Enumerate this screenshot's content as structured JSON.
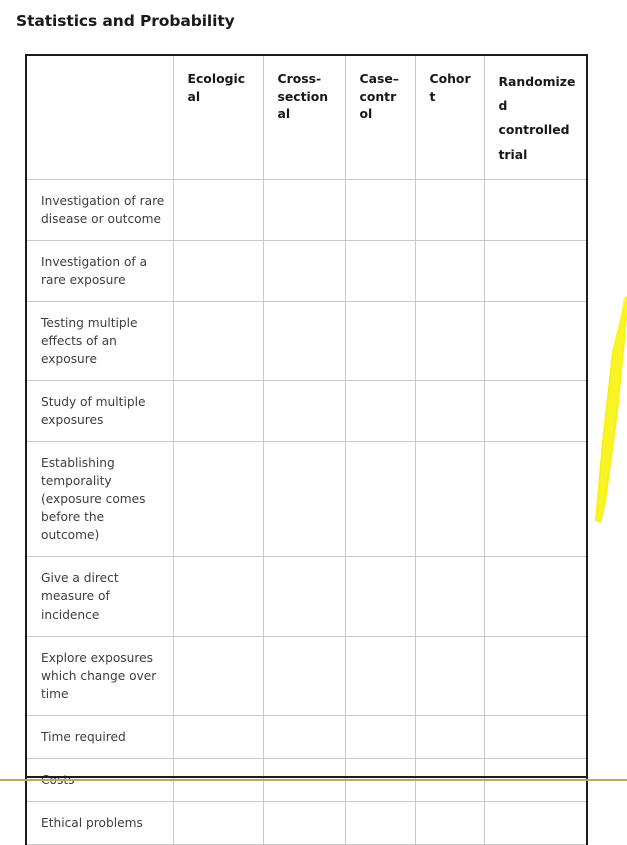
{
  "page": {
    "title": "Statistics and Probability",
    "background_color": "#ffffff",
    "bottom_rule_color": "#c8a464",
    "table_border_color": "#1c1c1c",
    "grid_line_color": "#c9c9c9"
  },
  "table": {
    "corner_header": "",
    "columns": [
      {
        "label": "Ecological"
      },
      {
        "label": "Cross-sectional"
      },
      {
        "label": "Case–control"
      },
      {
        "label": "Randomized controlled trial"
      },
      {
        "label": "Cohort"
      }
    ],
    "column_headers": {
      "ecological": "Ecological",
      "cross_sectional": "Cross-sectional",
      "case_control": "Case–control",
      "cohort": "Cohort",
      "randomized_controlled_trial": "Randomized controlled trial"
    },
    "rows": [
      {
        "label": "Investigation of rare disease or outcome",
        "cells": [
          "",
          "",
          "",
          "",
          ""
        ]
      },
      {
        "label": "Investigation of a rare exposure",
        "cells": [
          "",
          "",
          "",
          "",
          ""
        ]
      },
      {
        "label": "Testing multiple effects of an exposure",
        "cells": [
          "",
          "",
          "",
          "",
          ""
        ]
      },
      {
        "label": "Study of multiple exposures",
        "cells": [
          "",
          "",
          "",
          "",
          ""
        ]
      },
      {
        "label": "Establishing temporality (exposure comes before the outcome)",
        "cells": [
          "",
          "",
          "",
          "",
          ""
        ]
      },
      {
        "label": "Give a direct measure of incidence",
        "cells": [
          "",
          "",
          "",
          "",
          ""
        ]
      },
      {
        "label": "Explore exposures which change over time",
        "cells": [
          "",
          "",
          "",
          "",
          ""
        ]
      },
      {
        "label": "Time required",
        "cells": [
          "",
          "",
          "",
          "",
          ""
        ]
      },
      {
        "label": "Costs",
        "cells": [
          "",
          "",
          "",
          "",
          ""
        ]
      },
      {
        "label": "Ethical problems",
        "cells": [
          "",
          "",
          "",
          "",
          ""
        ]
      }
    ]
  },
  "annotation": {
    "highlight_stroke": {
      "name": "yellow-highlighter-stroke",
      "color": "#f7f011",
      "shape": "diagonal hand-drawn marker line"
    }
  }
}
